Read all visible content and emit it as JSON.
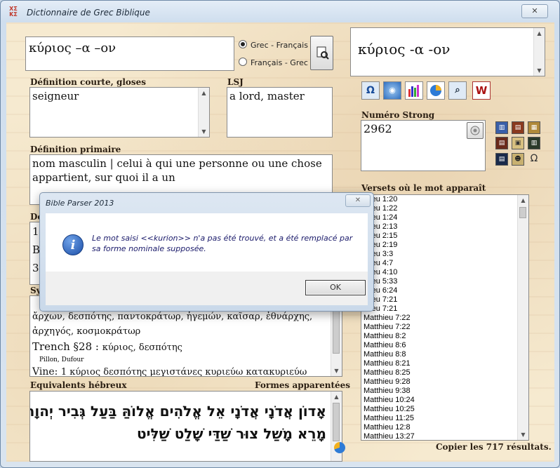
{
  "window": {
    "title": "Dictionnaire de Grec Biblique",
    "close": "✕",
    "icon": "ΧΣ ΚΣ"
  },
  "search": {
    "value": "κύριος –α –ον"
  },
  "direction": {
    "options": [
      {
        "label": "Grec - Français",
        "selected": true
      },
      {
        "label": "Français - Grec",
        "selected": false
      }
    ]
  },
  "lemma_display": {
    "value": "κύριος -α -ον"
  },
  "labels": {
    "short_def": "Définition courte, gloses",
    "lsj": "LSJ",
    "strong": "Numéro Strong",
    "primary_def": "Définition primaire",
    "verses": "Versets où le mot apparaît",
    "hebrew": "Equivalents hébreux",
    "related": "Formes apparentées",
    "def_prefix": "De",
    "syn_prefix": "Sy"
  },
  "short_def": {
    "value": "seigneur"
  },
  "lsj": {
    "value": "a lord, master"
  },
  "strong": {
    "value": "2962"
  },
  "primary_def": {
    "value": "nom masculin  | celui à qui une personne ou une chose appartient, sur quoi il a un"
  },
  "def_fragments": [
    "12",
    "B",
    "37"
  ],
  "synonyms": {
    "line1": "ἄρχων, δεσπότης, παντοκράτωρ, ἡγεμών, καῖσαρ, ἐθνάρχης,",
    "line2": "ἀρχηγός, κοσμοκράτωρ",
    "trench_label": "Trench §28 :",
    "trench_words": "κύριος, δεσπότης",
    "pillon": "Pillon, Dufour",
    "vine_label": "Vine:",
    "vine_words": "1 κύριος δεσπότης μεγιστάνες κυριεύω κατακυριεύω"
  },
  "hebrew": {
    "line1": "אָדוֹן אֲדֹנָי אֲדֹנָי אֵל אֱלֹהִים אֱלוֹהַּ בַּעַל גְּבִיר יְהוָה",
    "line2": "מָרֵא מָשַׁל צוּר שַׁדַּי שָׁלַט שַׁלִּיט"
  },
  "verses": {
    "items": [
      "thieu 1:20",
      "thieu 1:22",
      "thieu 1:24",
      "thieu 2:13",
      "thieu 2:15",
      "thieu 2:19",
      "thieu 3:3",
      "thieu 4:7",
      "thieu 4:10",
      "thieu 5:33",
      "thieu 6:24",
      "thieu 7:21",
      "thieu 7:21",
      "Matthieu 7:22",
      "Matthieu 7:22",
      "Matthieu 8:2",
      "Matthieu 8:6",
      "Matthieu 8:8",
      "Matthieu 8:21",
      "Matthieu 8:25",
      "Matthieu 9:28",
      "Matthieu 9:38",
      "Matthieu 10:24",
      "Matthieu 10:25",
      "Matthieu 11:25",
      "Matthieu 12:8",
      "Matthieu 13:27"
    ],
    "copy_label": "Copier les 717 résultats."
  },
  "toolbar_icons": [
    "omega-icon",
    "search-globe-icon",
    "chart-bars-icon",
    "pie-chart-icon",
    "magnifier-icon",
    "w-logo-icon"
  ],
  "dialog": {
    "title": "Bible Parser 2013",
    "close": "✕",
    "message": "Le mot saisi <<kurion>> n'a pas été trouvé, et a été remplacé par sa forme nominale supposée.",
    "ok": "OK"
  }
}
